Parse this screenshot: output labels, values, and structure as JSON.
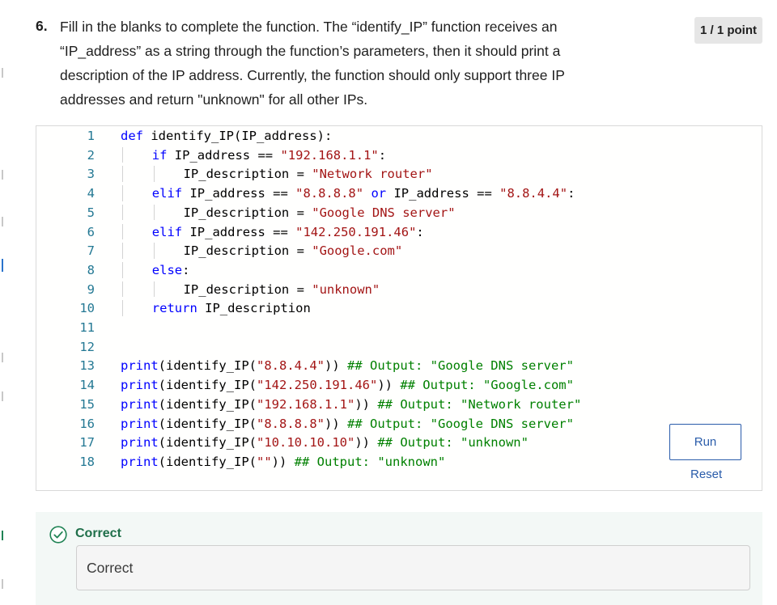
{
  "question": {
    "number": "6.",
    "text": "Fill in the blanks to complete the function. The “identify_IP” function receives an “IP_address” as a string through the function’s parameters, then it should print a description of the IP address. Currently, the function should only support three IP addresses and return \"unknown\" for all other IPs.",
    "points": "1 / 1 point"
  },
  "code_lines": [
    {
      "num": "1",
      "indent": 0,
      "tokens": [
        [
          "kw",
          "def"
        ],
        [
          "pl",
          " identify_IP(IP_address):"
        ]
      ]
    },
    {
      "num": "2",
      "indent": 1,
      "tokens": [
        [
          "kw",
          "if"
        ],
        [
          "pl",
          " IP_address == "
        ],
        [
          "str",
          "\"192.168.1.1\""
        ],
        [
          "pl",
          ":"
        ]
      ]
    },
    {
      "num": "3",
      "indent": 2,
      "tokens": [
        [
          "pl",
          "IP_description = "
        ],
        [
          "str",
          "\"Network router\""
        ]
      ]
    },
    {
      "num": "4",
      "indent": 1,
      "tokens": [
        [
          "kw",
          "elif"
        ],
        [
          "pl",
          " IP_address == "
        ],
        [
          "str",
          "\"8.8.8.8\""
        ],
        [
          "pl",
          " "
        ],
        [
          "kw",
          "or"
        ],
        [
          "pl",
          " IP_address == "
        ],
        [
          "str",
          "\"8.8.4.4\""
        ],
        [
          "pl",
          ":"
        ]
      ]
    },
    {
      "num": "5",
      "indent": 2,
      "tokens": [
        [
          "pl",
          "IP_description = "
        ],
        [
          "str",
          "\"Google DNS server\""
        ]
      ]
    },
    {
      "num": "6",
      "indent": 1,
      "tokens": [
        [
          "kw",
          "elif"
        ],
        [
          "pl",
          " IP_address == "
        ],
        [
          "str",
          "\"142.250.191.46\""
        ],
        [
          "pl",
          ":"
        ]
      ]
    },
    {
      "num": "7",
      "indent": 2,
      "tokens": [
        [
          "pl",
          "IP_description = "
        ],
        [
          "str",
          "\"Google.com\""
        ]
      ]
    },
    {
      "num": "8",
      "indent": 1,
      "tokens": [
        [
          "kw",
          "else"
        ],
        [
          "pl",
          ":"
        ]
      ]
    },
    {
      "num": "9",
      "indent": 2,
      "tokens": [
        [
          "pl",
          "IP_description = "
        ],
        [
          "str",
          "\"unknown\""
        ]
      ]
    },
    {
      "num": "10",
      "indent": 1,
      "tokens": [
        [
          "kw",
          "return"
        ],
        [
          "pl",
          " IP_description"
        ]
      ]
    },
    {
      "num": "11",
      "indent": 0,
      "tokens": []
    },
    {
      "num": "12",
      "indent": 0,
      "tokens": []
    },
    {
      "num": "13",
      "indent": 0,
      "tokens": [
        [
          "kw",
          "print"
        ],
        [
          "pl",
          "(identify_IP("
        ],
        [
          "str",
          "\"8.8.4.4\""
        ],
        [
          "pl",
          "))"
        ],
        [
          "cm",
          " ## Output: \"Google DNS server\""
        ]
      ]
    },
    {
      "num": "14",
      "indent": 0,
      "tokens": [
        [
          "kw",
          "print"
        ],
        [
          "pl",
          "(identify_IP("
        ],
        [
          "str",
          "\"142.250.191.46\""
        ],
        [
          "pl",
          "))"
        ],
        [
          "cm",
          " ## Output: \"Google.com\""
        ]
      ]
    },
    {
      "num": "15",
      "indent": 0,
      "tokens": [
        [
          "kw",
          "print"
        ],
        [
          "pl",
          "(identify_IP("
        ],
        [
          "str",
          "\"192.168.1.1\""
        ],
        [
          "pl",
          "))"
        ],
        [
          "cm",
          " ## Output: \"Network router\""
        ]
      ]
    },
    {
      "num": "16",
      "indent": 0,
      "tokens": [
        [
          "kw",
          "print"
        ],
        [
          "pl",
          "(identify_IP("
        ],
        [
          "str",
          "\"8.8.8.8\""
        ],
        [
          "pl",
          "))"
        ],
        [
          "cm",
          " ## Output: \"Google DNS server\""
        ]
      ]
    },
    {
      "num": "17",
      "indent": 0,
      "tokens": [
        [
          "kw",
          "print"
        ],
        [
          "pl",
          "(identify_IP("
        ],
        [
          "str",
          "\"10.10.10.10\""
        ],
        [
          "pl",
          "))"
        ],
        [
          "cm",
          " ## Output: \"unknown\""
        ]
      ]
    },
    {
      "num": "18",
      "indent": 0,
      "tokens": [
        [
          "kw",
          "print"
        ],
        [
          "pl",
          "(identify_IP("
        ],
        [
          "str",
          "\"\""
        ],
        [
          "pl",
          "))"
        ],
        [
          "cm",
          " ## Output: \"unknown\""
        ]
      ]
    }
  ],
  "controls": {
    "run_label": "Run",
    "reset_label": "Reset"
  },
  "feedback": {
    "status": "Correct",
    "message": "Correct",
    "icon": "check-circle-icon"
  },
  "colors": {
    "keyword": "#0000ff",
    "string": "#a31515",
    "comment": "#008000",
    "line_number": "#237893",
    "link": "#2a5caa",
    "success": "#1f6f4a"
  }
}
